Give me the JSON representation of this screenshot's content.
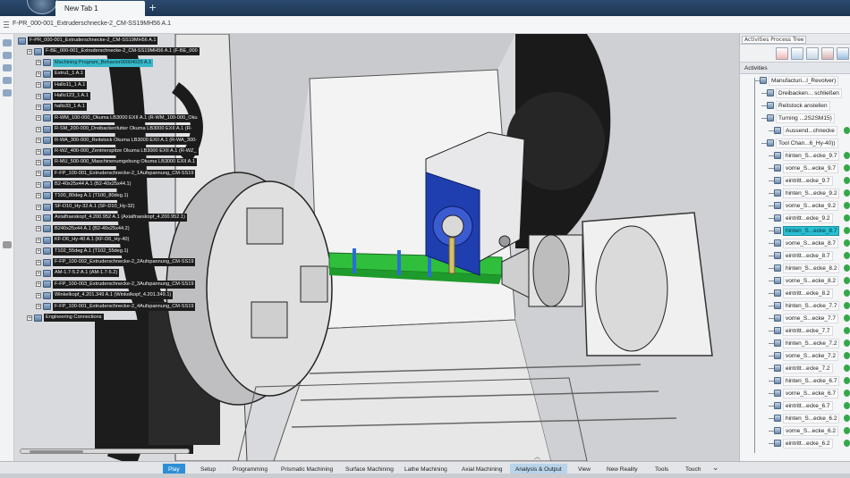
{
  "window": {
    "tab_label": "New Tab 1",
    "new_tab_symbol": "+",
    "document_title": "F-PR_000-001_Extruderschnecke-2_CM-SS19MH56 A.1"
  },
  "spec_tree": [
    {
      "label": "F-PR_000-001_Extruderschnecke-2_CM-SS19MH56 A.1",
      "depth": 0,
      "selected": false
    },
    {
      "label": "F-BE_000-001_Extruderschnecke-2_CM-SS19MH56 A.1 (F-BE_000",
      "depth": 1,
      "selected": false
    },
    {
      "label": "Machining Program_Behavior00004025 A.1",
      "depth": 2,
      "selected": true
    },
    {
      "label": "Extru1_1 A.1",
      "depth": 2,
      "selected": false
    },
    {
      "label": "Hallo11_1 A.1",
      "depth": 2,
      "selected": false
    },
    {
      "label": "Hallo123_1 A.1",
      "depth": 2,
      "selected": false
    },
    {
      "label": "hallo33_1 A.1",
      "depth": 2,
      "selected": false
    },
    {
      "label": "R-WM_100-000_Okuma LB3000 EXII A.1 (R-WM_100-000_Oku",
      "depth": 2,
      "selected": false
    },
    {
      "label": "R-SM_200-000_Dreibackenfutter Okuma LB3000 EXII A.1 (R-",
      "depth": 2,
      "selected": false
    },
    {
      "label": "R-WA_300-000_Reitstock Okuma LB3000 EXII A.1 (R-WA_300-",
      "depth": 2,
      "selected": false
    },
    {
      "label": "R-WZ_400-000_Zentrierspitze Okuma LB3000 EXII A.1 (R-WZ_",
      "depth": 2,
      "selected": false
    },
    {
      "label": "R-MU_500-000_Maschinenumgebung Okuma LB3000 EXII A.1",
      "depth": 2,
      "selected": false
    },
    {
      "label": "F-FP_100-001_Extruderschnecke-2_1Aufspannung_CM-SS19",
      "depth": 2,
      "selected": false
    },
    {
      "label": "B2-40x25x44 A.1 (B2-40x25x44.1)",
      "depth": 2,
      "selected": false
    },
    {
      "label": "T100_80deg A.1 (T100_80deg.1)",
      "depth": 2,
      "selected": false
    },
    {
      "label": "SF-D10_Hy-32 A.1 (SF-D10_Hy-32)",
      "depth": 2,
      "selected": false
    },
    {
      "label": "Axialfraeskopf_4.200.952 A.1 (Axialfraeskopf_4.200.952.1)",
      "depth": 2,
      "selected": false
    },
    {
      "label": "B240x25x44 A.1 (B2-40x25x44.2)",
      "depth": 2,
      "selected": false
    },
    {
      "label": "KF-D6_Hy-40 A.1 (KF-D6_Hy-40)",
      "depth": 2,
      "selected": false
    },
    {
      "label": "T102_55deg A.1 (T102_55deg.1)",
      "depth": 2,
      "selected": false
    },
    {
      "label": "F-FP_100-002_Extruderschnecke-2_2Aufspannung_CM-SS19",
      "depth": 2,
      "selected": false
    },
    {
      "label": "AM-1.7-5.2 A.1 (AM-1.7-5.2)",
      "depth": 2,
      "selected": false
    },
    {
      "label": "F-FP_100-003_Extruderschnecke-2_3Aufspannung_CM-SS19",
      "depth": 2,
      "selected": false
    },
    {
      "label": "Winkelkopf_4.201.349 A.1 (Winkelkopf_4.201.349.1)",
      "depth": 2,
      "selected": false
    },
    {
      "label": "F-FP_100-001_Extruderschnecke-2_4Aufspannung_CM-SS19",
      "depth": 2,
      "selected": false
    },
    {
      "label": "Engineering Connections",
      "depth": 1,
      "selected": false
    }
  ],
  "right_panel": {
    "tab_label": "Activities Process Tree",
    "header": "Activities",
    "items": [
      {
        "label": "Manufacturi...l_Revolver)",
        "indent": 1,
        "selected": false,
        "check": false
      },
      {
        "label": "Dreibacken... schließen",
        "indent": 2,
        "selected": false,
        "check": false
      },
      {
        "label": "Reitstock anstellen",
        "indent": 2,
        "selected": false,
        "check": false
      },
      {
        "label": "Turning ...2S2SM15)",
        "indent": 2,
        "selected": false,
        "check": false
      },
      {
        "label": "Aussend...chnecke",
        "indent": 3,
        "selected": false,
        "check": true
      },
      {
        "label": "Tool Chan...6_Hy-40))",
        "indent": 2,
        "selected": false,
        "check": false
      },
      {
        "label": "hinten_S...ecke_9.7",
        "indent": 3,
        "selected": false,
        "check": true
      },
      {
        "label": "vorne_S...ecke_9.7",
        "indent": 3,
        "selected": false,
        "check": true
      },
      {
        "label": "eintritt...ecke_9.7",
        "indent": 3,
        "selected": false,
        "check": true
      },
      {
        "label": "hinten_S...ecke_9.2",
        "indent": 3,
        "selected": false,
        "check": true
      },
      {
        "label": "vorne_S...ecke_9.2",
        "indent": 3,
        "selected": false,
        "check": true
      },
      {
        "label": "eintritt...ecke_9.2",
        "indent": 3,
        "selected": false,
        "check": true
      },
      {
        "label": "hinten_S...ecke_8.7",
        "indent": 3,
        "selected": true,
        "check": true
      },
      {
        "label": "vorne_S...ecke_8.7",
        "indent": 3,
        "selected": false,
        "check": true
      },
      {
        "label": "eintritt...ecke_8.7",
        "indent": 3,
        "selected": false,
        "check": true
      },
      {
        "label": "hinten_S...ecke_8.2",
        "indent": 3,
        "selected": false,
        "check": true
      },
      {
        "label": "vorne_S...ecke_8.2",
        "indent": 3,
        "selected": false,
        "check": true
      },
      {
        "label": "eintritt...ecke_8.2",
        "indent": 3,
        "selected": false,
        "check": true
      },
      {
        "label": "hinten_S...ecke_7.7",
        "indent": 3,
        "selected": false,
        "check": true
      },
      {
        "label": "vorne_S...ecke_7.7",
        "indent": 3,
        "selected": false,
        "check": true
      },
      {
        "label": "eintritt...ecke_7.7",
        "indent": 3,
        "selected": false,
        "check": true
      },
      {
        "label": "hinten_S...ecke_7.2",
        "indent": 3,
        "selected": false,
        "check": true
      },
      {
        "label": "vorne_S...ecke_7.2",
        "indent": 3,
        "selected": false,
        "check": true
      },
      {
        "label": "eintritt...ecke_7.2",
        "indent": 3,
        "selected": false,
        "check": true
      },
      {
        "label": "hinten_S...ecke_6.7",
        "indent": 3,
        "selected": false,
        "check": true
      },
      {
        "label": "vorne_S...ecke_6.7",
        "indent": 3,
        "selected": false,
        "check": true
      },
      {
        "label": "eintritt...ecke_6.7",
        "indent": 3,
        "selected": false,
        "check": true
      },
      {
        "label": "hinten_S...ecke_6.2",
        "indent": 3,
        "selected": false,
        "check": true
      },
      {
        "label": "vorne_S...ecke_6.2",
        "indent": 3,
        "selected": false,
        "check": true
      },
      {
        "label": "eintritt...ecke_6.2",
        "indent": 3,
        "selected": false,
        "check": true
      }
    ]
  },
  "command_bar": {
    "tabs": [
      "Play",
      "Setup",
      "Programming",
      "Prismatic Machining",
      "Surface Machining",
      "Lathe Machining",
      "Axial Machining",
      "Analysis & Output",
      "View",
      "New Reality",
      "Tools",
      "Touch"
    ],
    "active_tab": "Play",
    "highlighted_tab": "Analysis & Output"
  },
  "colors": {
    "selection": "#38b8c8",
    "active_tab": "#2f8fd6",
    "workpiece": "#3fc94a",
    "spindle_housing": "#1f3fb0"
  },
  "icons": [
    "grip-icon",
    "app-logo-icon",
    "collapse-chevron-icon",
    "expand-chevron-icon",
    "status-check-icon"
  ]
}
